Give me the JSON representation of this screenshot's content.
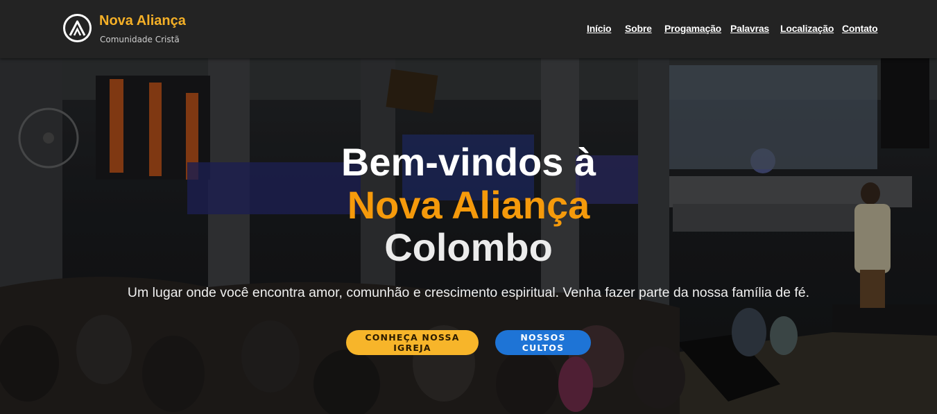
{
  "brand": {
    "name": "Nova Aliança",
    "subtitle": "Comunidade Cristã",
    "logo_icon": "triangle-a-logo-icon",
    "accent_color": "#f5b027"
  },
  "nav": {
    "items": [
      {
        "label": "Início"
      },
      {
        "label": "Sobre"
      },
      {
        "label": "Progamação"
      },
      {
        "label": "Palavras"
      },
      {
        "label": "Localização"
      },
      {
        "label": "Contato"
      }
    ]
  },
  "hero": {
    "title_line1": "Bem-vindos à",
    "title_line2": "Nova Aliança",
    "title_line3": "Colombo",
    "tagline": "Um lugar onde você encontra amor, comunhão e crescimento espiritual. Venha fazer parte da nossa família de fé.",
    "primary_button": "CONHEÇA NOSSA IGREJA",
    "secondary_button": "NOSSOS CULTOS",
    "primary_color": "#f7b52a",
    "secondary_color": "#1e74d6",
    "highlight_color": "#f59a0b"
  }
}
